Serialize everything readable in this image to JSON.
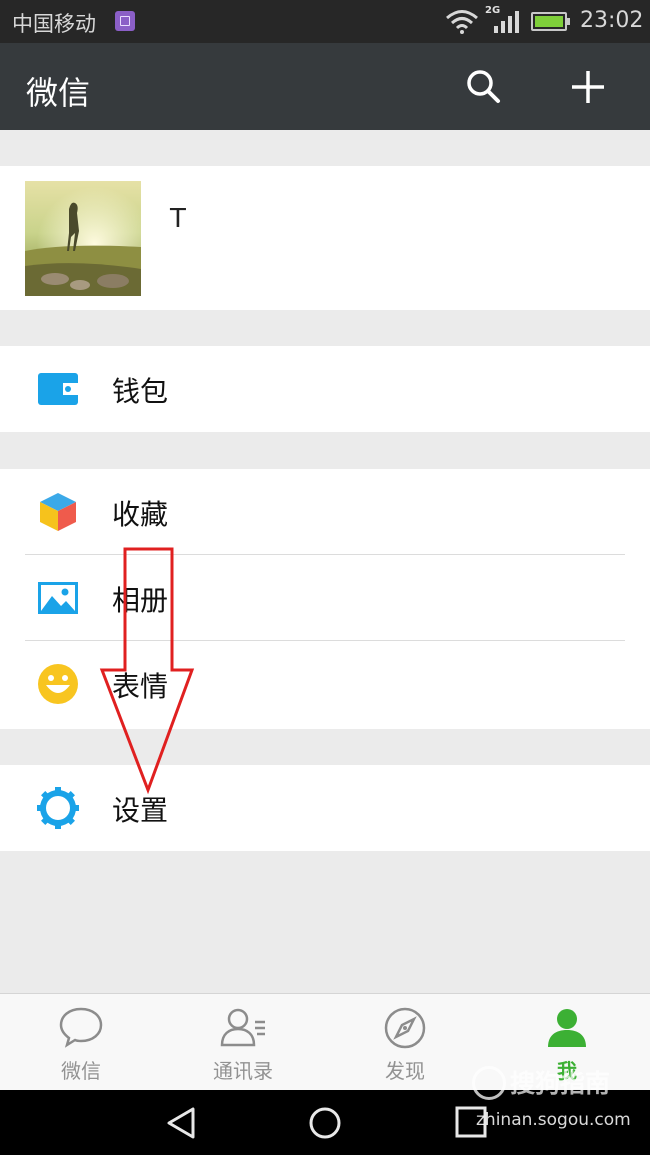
{
  "status_bar": {
    "carrier": "中国移动",
    "network": "2G",
    "time": "23:02"
  },
  "app_bar": {
    "title": "微信",
    "search_icon": "search-icon",
    "add_icon": "plus-icon"
  },
  "profile": {
    "name": "T"
  },
  "menu": {
    "wallet": "钱包",
    "favorites": "收藏",
    "album": "相册",
    "stickers": "表情",
    "settings": "设置"
  },
  "tabs": [
    {
      "label": "微信",
      "icon": "chat-bubble-icon"
    },
    {
      "label": "通讯录",
      "icon": "contacts-icon"
    },
    {
      "label": "发现",
      "icon": "compass-icon"
    },
    {
      "label": "我",
      "icon": "person-icon"
    }
  ],
  "colors": {
    "accent_green": "#3cb034",
    "wallet_blue": "#1aa3e8",
    "settings_blue": "#1aa3e8",
    "annotation_red": "#e02020"
  },
  "watermark": {
    "brand": "搜狗指南",
    "url": "zhinan.sogou.com"
  }
}
